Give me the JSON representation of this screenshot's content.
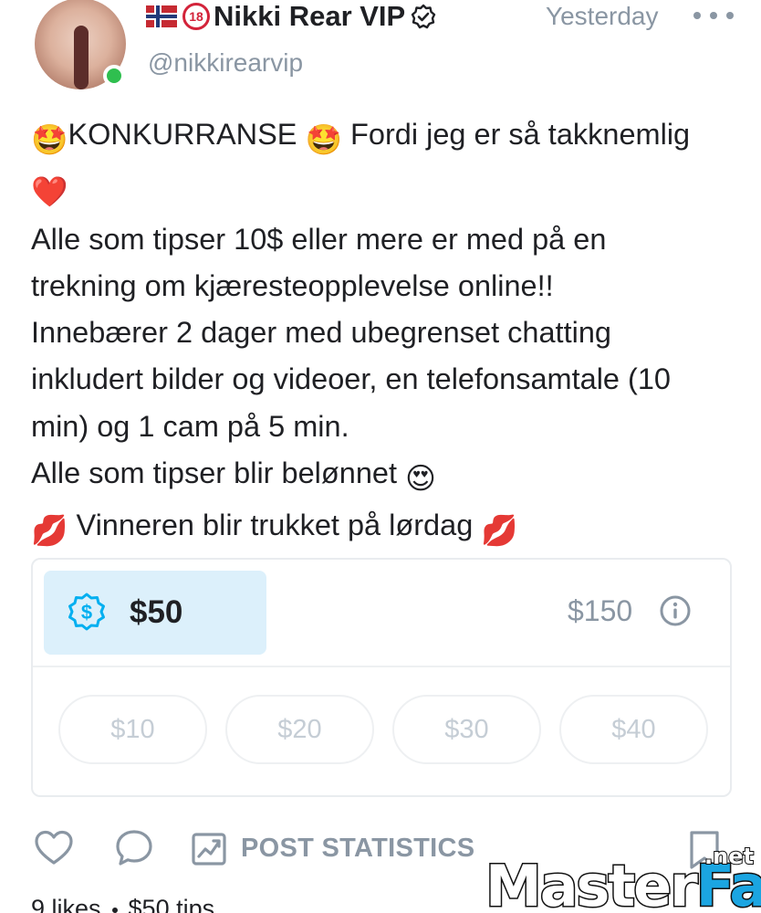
{
  "author": {
    "flag_icon": "norway-flag-icon",
    "age_badge": "18",
    "display_name": "Nikki Rear VIP",
    "verified_icon": "verified-badge-icon",
    "handle": "@nikkirearvip",
    "online": true
  },
  "timestamp": "Yesterday",
  "more_icon": "more-dots-icon",
  "post": {
    "lines": [
      {
        "lead_emoji": "🤩",
        "text": "KONKURRANSE",
        "mid_emoji": "🤩",
        "tail": "Fordi jeg er så takknemlig"
      },
      {
        "lead_emoji": "❤️"
      },
      {
        "text": "Alle som tipser 10$ eller mere er med på en"
      },
      {
        "text": "trekning om kjæresteopplevelse online!!"
      },
      {
        "text": "Innebærer 2 dager med ubegrenset chatting"
      },
      {
        "text": "inkludert bilder og videoer, en telefonsamtale (10"
      },
      {
        "text": "min) og 1 cam på 5 min."
      },
      {
        "text": "Alle som tipser blir belønnet",
        "tail_emoji": "😍"
      },
      {
        "lead_emoji": "💋",
        "text": "Vinneren blir trukket på lørdag",
        "tail_emoji": "💋"
      }
    ]
  },
  "tip_goal": {
    "icon": "dollar-badge-icon",
    "current": "$50",
    "goal": "$150",
    "info_icon": "info-icon",
    "progress_fraction": 0.333,
    "options": [
      "$10",
      "$20",
      "$30",
      "$40"
    ]
  },
  "actions": {
    "like_icon": "heart-icon",
    "comment_icon": "comment-icon",
    "stats_icon": "chart-icon",
    "stats_label": "POST STATISTICS",
    "bookmark_icon": "bookmark-icon"
  },
  "counts": {
    "likes": "9 likes",
    "tips": "$50 tips"
  },
  "watermark": {
    "part1": "Master",
    "part2": "Fap",
    "suffix": ".net"
  },
  "colors": {
    "accent": "#00aff0",
    "muted": "#8a96a3",
    "tip_highlight": "#dcf0fb",
    "online": "#2fbf4f"
  }
}
